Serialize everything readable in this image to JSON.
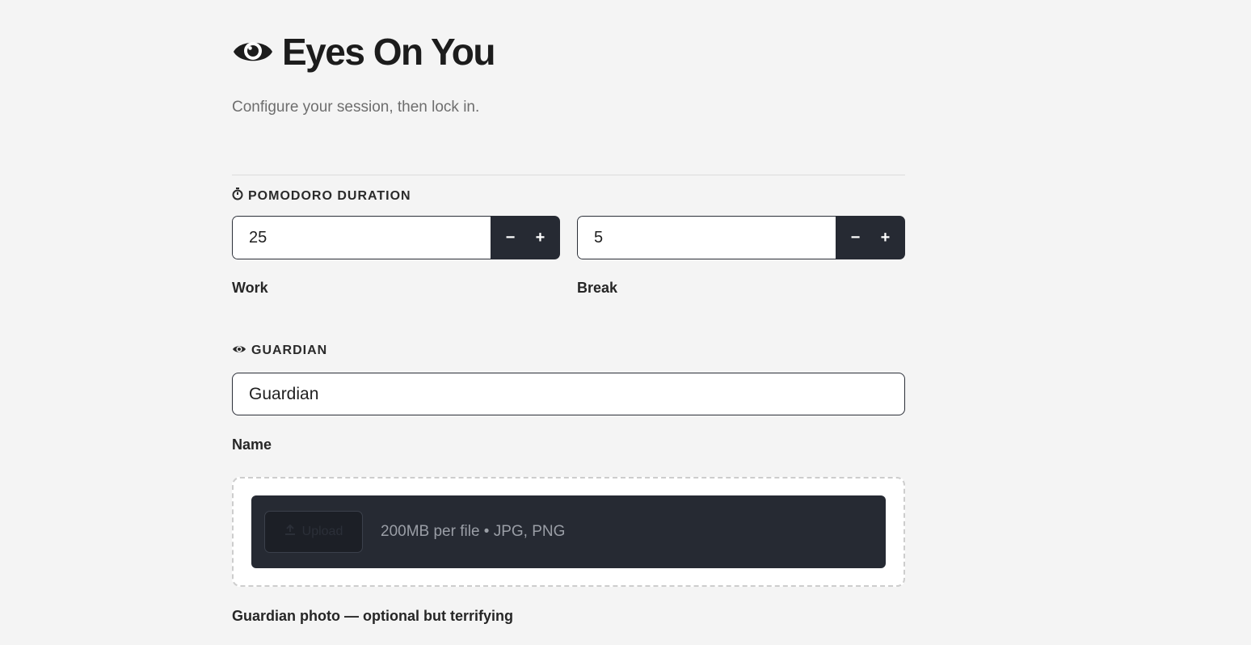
{
  "header": {
    "title": "Eyes On You",
    "subtitle": "Configure your session, then lock in.",
    "title_icon": "eye-icon"
  },
  "pomodoro": {
    "heading": "POMODORO DURATION",
    "heading_icon": "stopwatch-icon",
    "work": {
      "value": "25",
      "label": "Work",
      "minus": "−",
      "plus": "+"
    },
    "break": {
      "value": "5",
      "label": "Break",
      "minus": "−",
      "plus": "+"
    }
  },
  "guardian": {
    "heading": "GUARDIAN",
    "heading_icon": "eye-icon",
    "name_value": "Guardian",
    "name_label": "Name",
    "upload": {
      "button_label": "Upload",
      "button_icon": "upload-icon",
      "hint": "200MB per file • JPG, PNG"
    },
    "photo_label": "Guardian photo — optional but terrifying"
  },
  "colors": {
    "background": "#f4f4f4",
    "dark_accent": "#262a33",
    "text": "#1f1f1f"
  }
}
